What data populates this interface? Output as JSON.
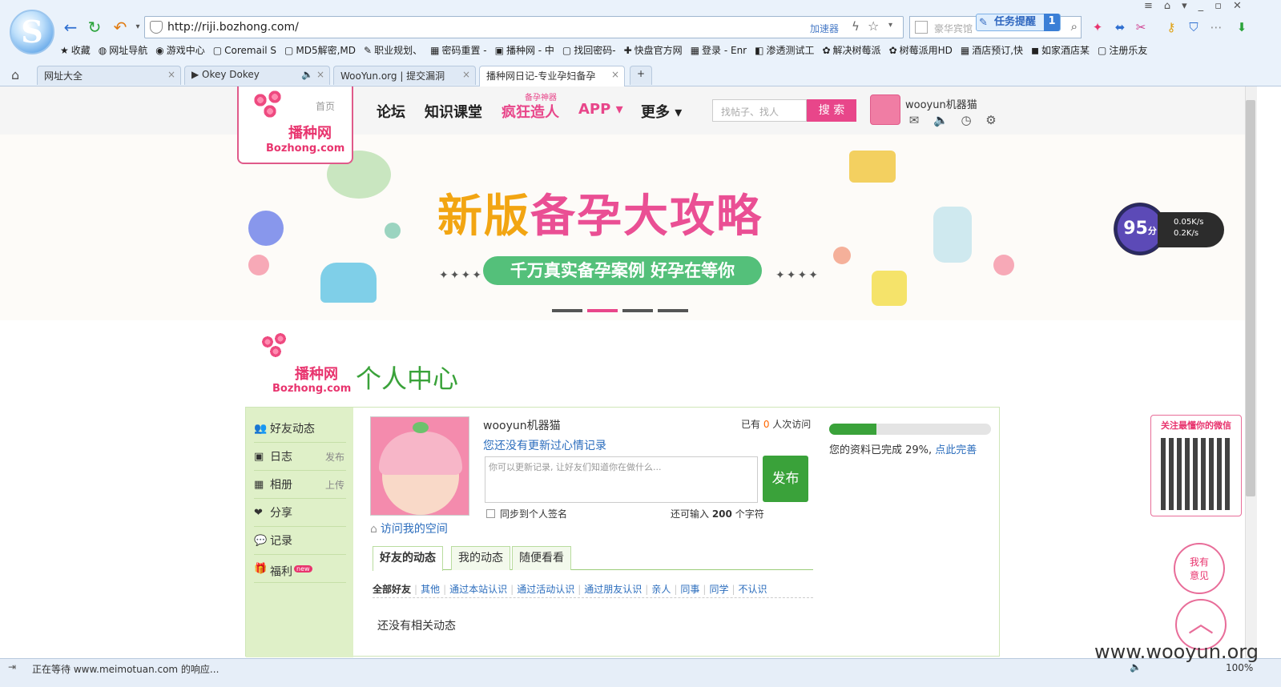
{
  "browser": {
    "url": "http://riji.bozhong.com/",
    "accelerator": "加速器",
    "search_placeholder": "豪华宾馆",
    "task_label": "任务提醒",
    "task_count": "1",
    "bookmarks": [
      "收藏",
      "网址导航",
      "游戏中心",
      "Coremail S",
      "MD5解密,MD",
      "职业规划、",
      "密码重置 -",
      "播种网 - 中",
      "找回密码-",
      "快盘官方网",
      "登录 - Enr",
      "渗透测试工",
      "解决树莓派",
      "树莓派用HD",
      "酒店预订,快",
      "如家酒店某",
      "注册乐友"
    ],
    "tabs": [
      "网址大全",
      "▶ Okey Dokey",
      "WooYun.org | 提交漏洞",
      "播种网日记-专业孕妇备孕"
    ],
    "status_text": "正在等待 www.meimotuan.com 的响应...",
    "zoom": "100%",
    "net_up": "0.05K/s",
    "net_down": "0.2K/s",
    "score": "95",
    "score_unit": "分"
  },
  "header": {
    "home": "首页",
    "logo_cn": "播种网",
    "logo_en": "Bozhong.com",
    "nav": [
      "论坛",
      "知识课堂",
      "疯狂造人",
      "APP ▾",
      "更多 ▾"
    ],
    "crazy_tag": "备孕神器",
    "search_placeholder": "找帖子、找人",
    "search_button": "搜 索",
    "username": "wooyun机器猫"
  },
  "banner": {
    "title_a": "新版",
    "title_b": "备孕大攻略",
    "subtitle": "千万真实备孕案例  好孕在等你",
    "dots": "✦✦✦✦",
    "slides": [
      false,
      true,
      false,
      false
    ]
  },
  "center": {
    "title": "个人中心",
    "side_items": [
      {
        "icon": "👥",
        "label": "好友动态",
        "right": ""
      },
      {
        "icon": "▣",
        "label": "日志",
        "right": "发布"
      },
      {
        "icon": "▦",
        "label": "相册",
        "right": "上传"
      },
      {
        "icon": "❤",
        "label": "分享",
        "right": ""
      },
      {
        "icon": "💬",
        "label": "记录",
        "right": ""
      },
      {
        "icon": "🎁",
        "label": "福利",
        "right": ""
      }
    ],
    "new_badge": "new",
    "name": "wooyun机器猫",
    "visits_prefix": "已有 ",
    "visits_count": "0",
    "visits_suffix": " 人次访问",
    "mood_link": "您还没有更新过心情记录",
    "mood_placeholder": "你可以更新记录, 让好友们知道你在做什么...",
    "publish": "发布",
    "sync_label": "同步到个人签名",
    "remain_prefix": "还可输入 ",
    "remain_count": "200",
    "remain_suffix": " 个字符",
    "visit_space": "访问我的空间",
    "profile_percent": 29,
    "profile_text": "您的资料已完成 29%, ",
    "profile_link": "点此完善",
    "tabs": [
      "好友的动态",
      "我的动态",
      "随便看看"
    ],
    "filters": [
      "全部好友",
      "其他",
      "通过本站认识",
      "通过活动认识",
      "通过朋友认识",
      "亲人",
      "同事",
      "同学",
      "不认识"
    ],
    "empty": "还没有相关动态"
  },
  "float": {
    "wechat_title": "关注最懂你的微信",
    "feedback": "我有\n意见"
  },
  "watermark": "www.wooyun.org"
}
